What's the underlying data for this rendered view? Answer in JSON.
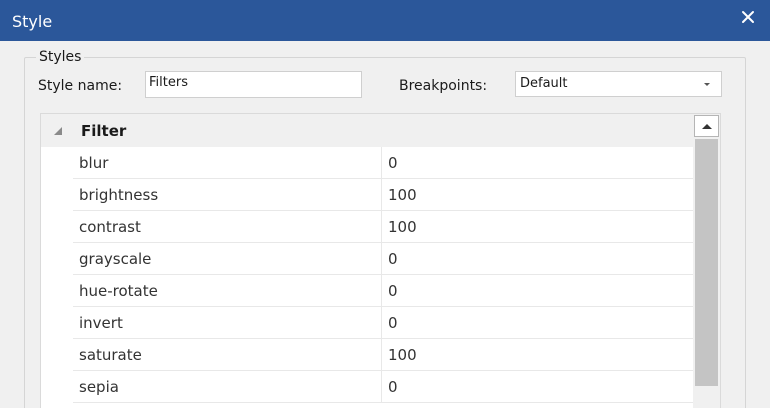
{
  "window": {
    "title": "Style"
  },
  "styles_group": {
    "legend": "Styles",
    "style_name_label": "Style name:",
    "style_name_value": "Filters",
    "breakpoints_label": "Breakpoints:",
    "breakpoints_value": "Default"
  },
  "property_grid": {
    "category": "Filter",
    "rows": [
      {
        "name": "blur",
        "value": "0"
      },
      {
        "name": "brightness",
        "value": "100"
      },
      {
        "name": "contrast",
        "value": "100"
      },
      {
        "name": "grayscale",
        "value": "0"
      },
      {
        "name": "hue-rotate",
        "value": "0"
      },
      {
        "name": "invert",
        "value": "0"
      },
      {
        "name": "saturate",
        "value": "100"
      },
      {
        "name": "sepia",
        "value": "0"
      }
    ]
  },
  "icons": {
    "close": "close-icon",
    "expander": "collapse-triangle-icon",
    "dropdown": "chevron-down-icon",
    "scroll_up": "scroll-up-arrow-icon"
  },
  "colors": {
    "titlebar": "#2b579a",
    "dialog_bg": "#f0f0f0",
    "scroll_thumb": "#c4c4c4"
  }
}
